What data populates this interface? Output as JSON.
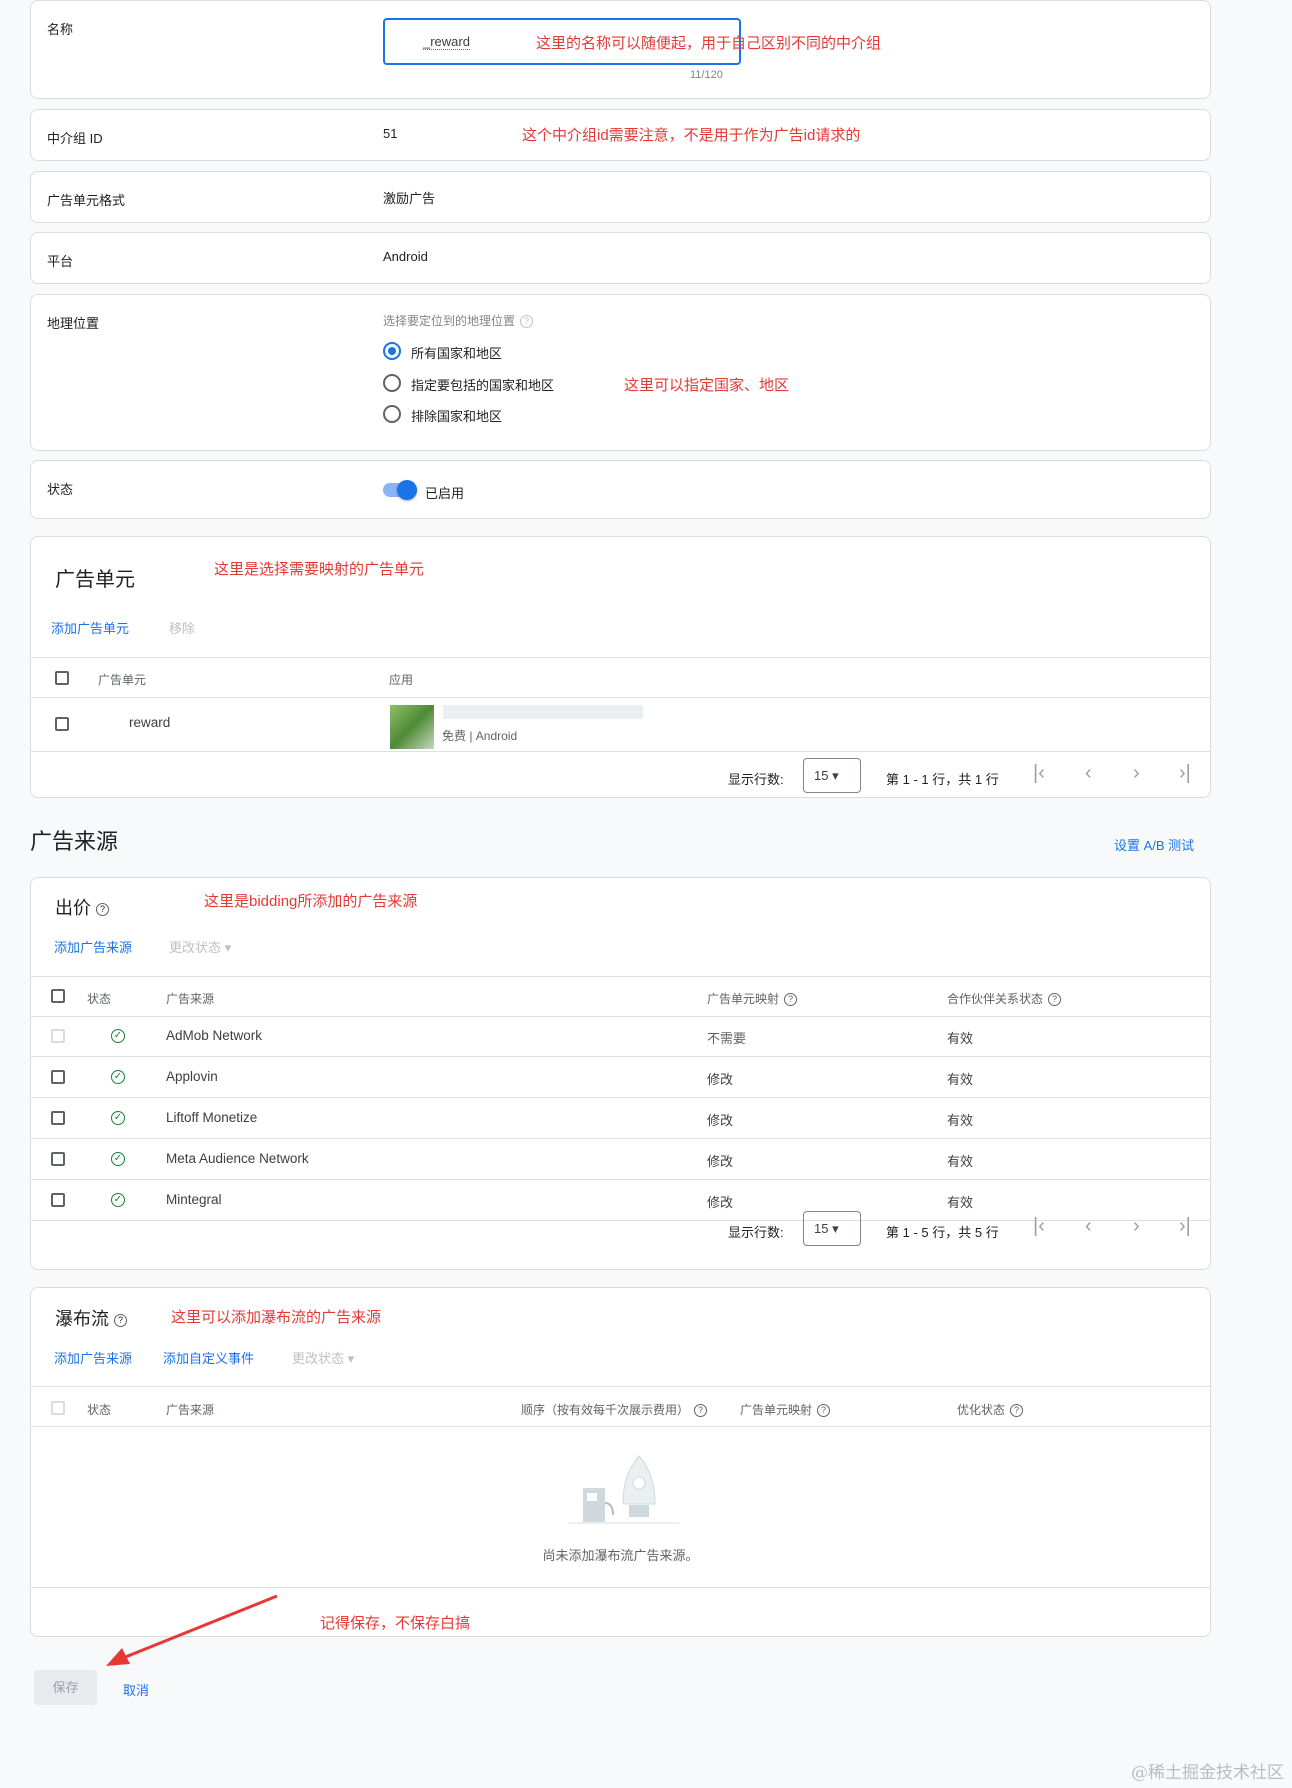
{
  "details": {
    "name_label": "名称",
    "name_value": "_reward",
    "name_counter": "11/120",
    "id_label": "中介组 ID",
    "id_value": "51",
    "format_label": "广告单元格式",
    "format_value": "激励广告",
    "platform_label": "平台",
    "platform_value": "Android",
    "geo_label": "地理位置",
    "geo_hint": "选择要定位到的地理位置",
    "geo_options": [
      "所有国家和地区",
      "指定要包括的国家和地区",
      "排除国家和地区"
    ],
    "status_label": "状态",
    "status_value": "已启用"
  },
  "notes": {
    "name": "这里的名称可以随便起，用于自己区别不同的中介组",
    "id": "这个中介组id需要注意，不是用于作为广告id请求的",
    "geo": "这里可以指定国家、地区",
    "adunit": "这里是选择需要映射的广告单元",
    "bidding": "这里是bidding所添加的广告来源",
    "waterfall": "这里可以添加瀑布流的广告来源",
    "save": "记得保存，不保存白搞"
  },
  "adunits": {
    "title": "广告单元",
    "add": "添加广告单元",
    "remove": "移除",
    "headers": [
      "广告单元",
      "应用"
    ],
    "row": {
      "name": "reward",
      "app_meta": "免费 | Android"
    },
    "rows_label": "显示行数:",
    "rows_value": "15",
    "range": "第 1 - 1 行，共 1 行"
  },
  "sources": {
    "heading": "广告来源",
    "ab_test": "设置 A/B 测试"
  },
  "bidding": {
    "title": "出价",
    "add": "添加广告来源",
    "change_status": "更改状态",
    "headers": [
      "状态",
      "广告来源",
      "广告单元映射",
      "合作伙伴关系状态"
    ],
    "rows": [
      {
        "source": "AdMob Network",
        "mapping": "不需要",
        "partner": "有效"
      },
      {
        "source": "Applovin",
        "mapping": "修改",
        "partner": "有效"
      },
      {
        "source": "Liftoff Monetize",
        "mapping": "修改",
        "partner": "有效"
      },
      {
        "source": "Meta Audience Network",
        "mapping": "修改",
        "partner": "有效"
      },
      {
        "source": "Mintegral",
        "mapping": "修改",
        "partner": "有效"
      }
    ],
    "rows_label": "显示行数:",
    "rows_value": "15",
    "range": "第 1 - 5 行，共 5 行"
  },
  "waterfall": {
    "title": "瀑布流",
    "add": "添加广告来源",
    "add_event": "添加自定义事件",
    "change_status": "更改状态",
    "headers": [
      "状态",
      "广告来源",
      "顺序（按有效每千次展示费用）",
      "广告单元映射",
      "优化状态"
    ],
    "empty": "尚未添加瀑布流广告来源。"
  },
  "footer": {
    "save": "保存",
    "cancel": "取消"
  },
  "watermark": "@稀土掘金技术社区",
  "colors": {
    "accent": "#1a73e8",
    "annotation": "#e53935",
    "success": "#188038"
  }
}
